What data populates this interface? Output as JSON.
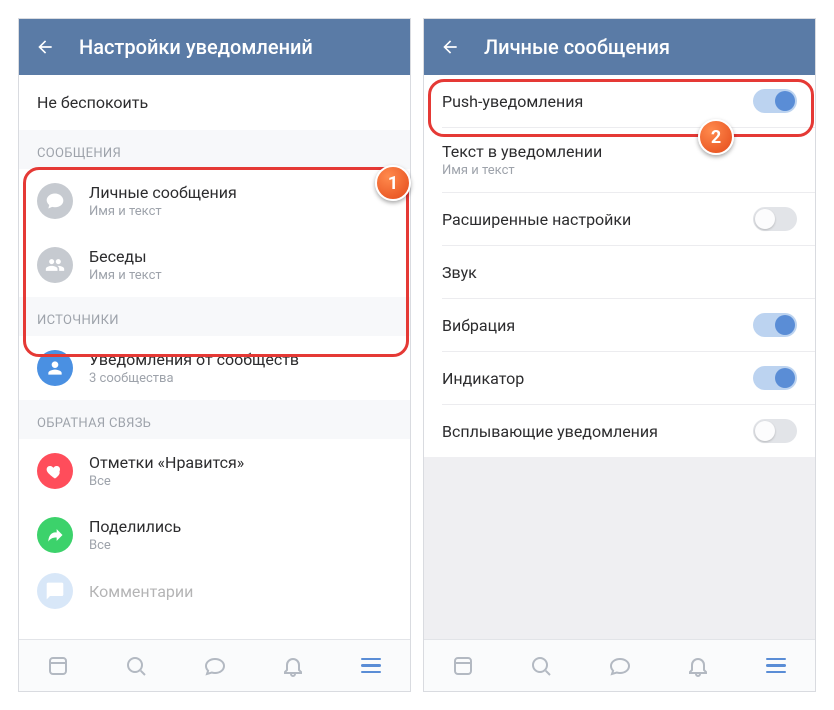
{
  "left": {
    "appbar_title": "Настройки уведомлений",
    "do_not_disturb": "Не беспокоить",
    "sections": {
      "messages_header": "СООБЩЕНИЯ",
      "personal_title": "Личные сообщения",
      "personal_sub": "Имя и текст",
      "chats_title": "Беседы",
      "chats_sub": "Имя и текст",
      "sources_header": "ИСТОЧНИКИ",
      "communities_title": "Уведомления от сообществ",
      "communities_sub": "3 сообщества",
      "feedback_header": "ОБРАТНАЯ СВЯЗЬ",
      "likes_title": "Отметки «Нравится»",
      "likes_sub": "Все",
      "shares_title": "Поделились",
      "shares_sub": "Все",
      "comments_title": "Комментарии"
    }
  },
  "right": {
    "appbar_title": "Личные сообщения",
    "rows": {
      "push_title": "Push-уведомления",
      "text_title": "Текст в уведомлении",
      "text_sub": "Имя и текст",
      "advanced_title": "Расширенные настройки",
      "sound_title": "Звук",
      "vibration_title": "Вибрация",
      "indicator_title": "Индикатор",
      "popup_title": "Всплывающие уведомления"
    },
    "toggles": {
      "push": "on",
      "advanced": "off",
      "vibration": "on",
      "indicator": "on",
      "popup": "off"
    }
  },
  "badges": {
    "one": "1",
    "two": "2"
  }
}
